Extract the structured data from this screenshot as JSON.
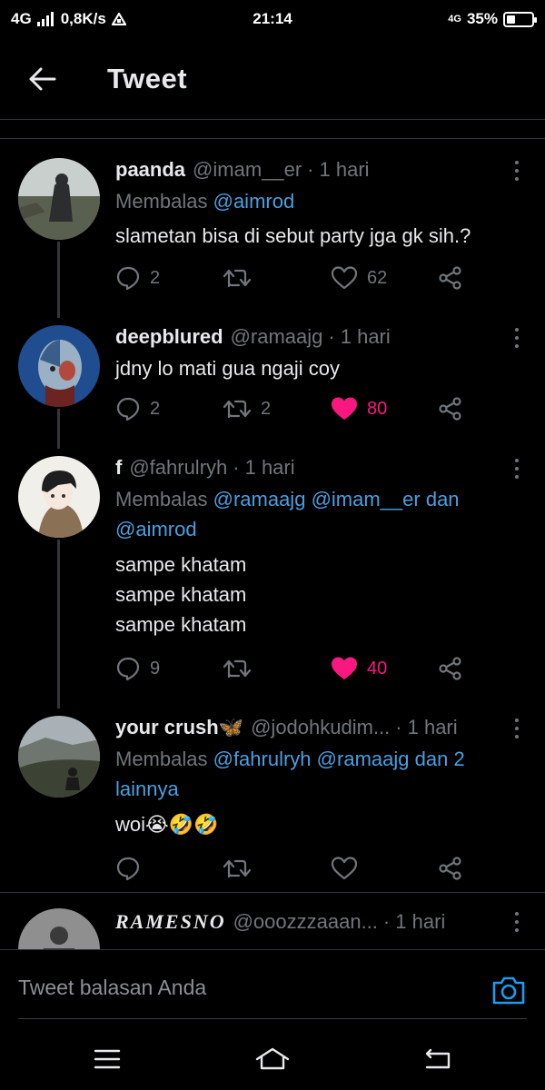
{
  "status_bar": {
    "network": "4G",
    "speed": "0,8K/s",
    "time": "21:14",
    "right_network": "4G",
    "battery_percent": "35%",
    "battery_level": 0.35
  },
  "header": {
    "title": "Tweet",
    "back_icon": "arrow-left-icon"
  },
  "tweets": [
    {
      "name": "paanda",
      "handle": "@imam__er",
      "time": "1 hari",
      "reply_prefix": "Membalas",
      "reply_mentions": [
        "@aimrod"
      ],
      "lines": [
        "slametan bisa di sebut party jga gk sih.?"
      ],
      "replies": "2",
      "retweets": "",
      "likes": "62",
      "liked": false
    },
    {
      "name": "deepblured",
      "handle": "@ramaajg",
      "time": "1 hari",
      "lines": [
        "jdny lo mati gua ngaji coy"
      ],
      "replies": "2",
      "retweets": "2",
      "likes": "80",
      "liked": true
    },
    {
      "name": "f",
      "handle": "@fahrulryh",
      "time": "1 hari",
      "reply_prefix": "Membalas",
      "reply_mentions": [
        "@ramaajg",
        "@imam__er",
        "dan",
        "@aimrod"
      ],
      "lines": [
        "sampe khatam",
        "sampe khatam",
        "sampe khatam"
      ],
      "replies": "9",
      "retweets": "",
      "likes": "40",
      "liked": true
    },
    {
      "name": "your crush🦋",
      "handle": "@jodohkudim...",
      "time": "1 hari",
      "reply_prefix": "Membalas",
      "reply_mentions": [
        "@fahrulryh",
        "@ramaajg",
        "dan 2 lainnya"
      ],
      "lines": [
        "woi😭🤣🤣"
      ],
      "replies": "",
      "retweets": "",
      "likes": "",
      "liked": false
    },
    {
      "name": "RAMESNO",
      "handle": "@ooozzzaaan...",
      "time": "1 hari"
    }
  ],
  "reply_bar": {
    "placeholder": "Tweet balasan Anda",
    "camera_icon": "camera-icon"
  },
  "nav_bar": {
    "icons": [
      "menu-icon",
      "home-icon",
      "back-icon"
    ]
  },
  "colors": {
    "background": "#000000",
    "text": "#e7e9ea",
    "secondary": "#71767b",
    "link": "#4a9fe0",
    "like": "#f91880"
  }
}
